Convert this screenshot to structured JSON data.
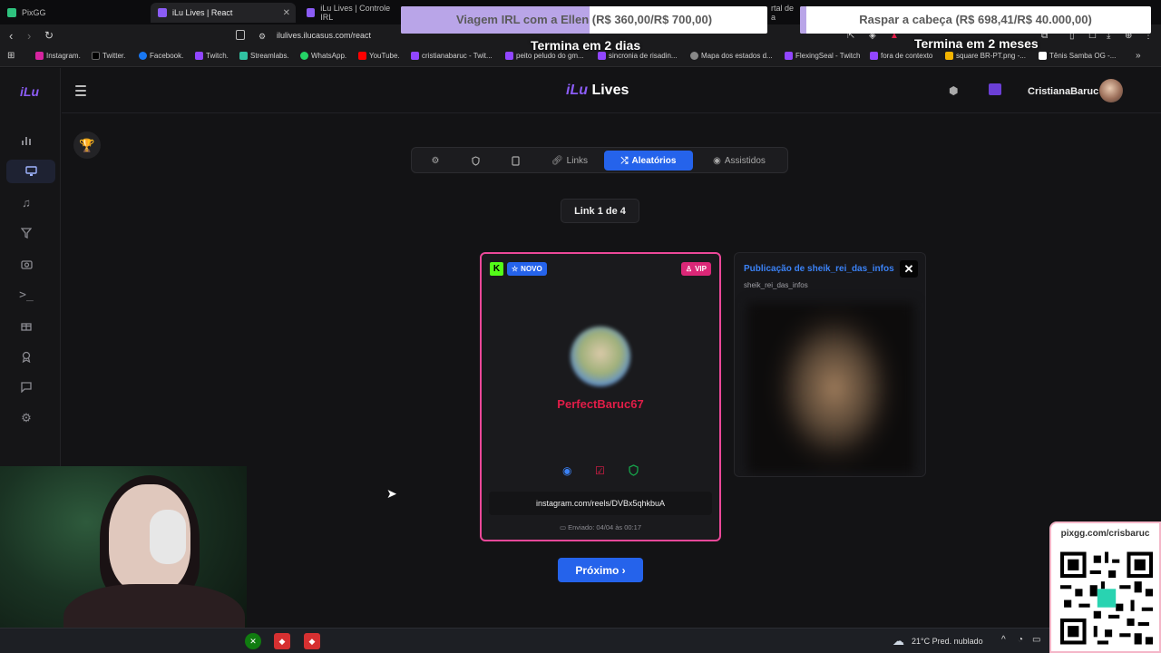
{
  "browser": {
    "tabs": [
      {
        "title": "PixGG",
        "active": false
      },
      {
        "title": "iLu Lives | React",
        "active": true
      },
      {
        "title": "iLu Lives | Controle IRL",
        "active": false
      },
      {
        "title": "rtal de a",
        "active": false
      }
    ],
    "url": "ilulives.ilucasus.com/react",
    "bookmarks": [
      "Instagram.",
      "Twitter.",
      "Facebook.",
      "Twitch.",
      "Streamlabs.",
      "WhatsApp.",
      "YouTube.",
      "cristianabaruc - Twit...",
      "peito peludo do gm...",
      "sincronia de risadin...",
      "Mapa dos estados d...",
      "FlexingSeal - Twitch",
      "fora de contexto",
      "square BR-PT.png -...",
      "Tênis Samba OG -..."
    ]
  },
  "overlays": {
    "goal1": {
      "text": "Viagem IRL com a Ellen (R$ 360,00/R$ 700,00)",
      "sub": "Termina em 2 dias",
      "progress": 0.514
    },
    "goal2": {
      "text": "Raspar a cabeça (R$ 698,41/R$ 40.000,00)",
      "sub": "Termina em 2 meses",
      "progress": 0.017
    },
    "qr_label": "pixgg.com/crisbaruc"
  },
  "app": {
    "brand_small": "iLu",
    "brand_title_ilu": "iLu",
    "brand_title_rest": " Lives",
    "username": "CristianaBaruc",
    "tabs": [
      {
        "label": ""
      },
      {
        "label": ""
      },
      {
        "label": ""
      },
      {
        "label": "Links"
      },
      {
        "label": "Aleatórios",
        "active": true
      },
      {
        "label": "Assistidos"
      }
    ],
    "counter": "Link 1 de 4",
    "card": {
      "badge_novo": "NOVO",
      "badge_vip": "VIP",
      "username": "PerfectBaruc67",
      "link": "instagram.com/reels/DVBx5qhkbuA",
      "date": "Enviado: 04/04 às 00:17"
    },
    "next_button": "Próximo ›",
    "preview": {
      "title": "Publicação de sheik_rei_das_infos",
      "user": "sheik_rei_das_infos"
    }
  },
  "taskbar": {
    "weather": "21°C  Pred. nublado"
  },
  "colors": {
    "accent": "#2563eb",
    "brand": "#8b5cf6",
    "card_border": "#ec4899",
    "username_red": "#e11d48",
    "kick_green": "#53fc18"
  }
}
